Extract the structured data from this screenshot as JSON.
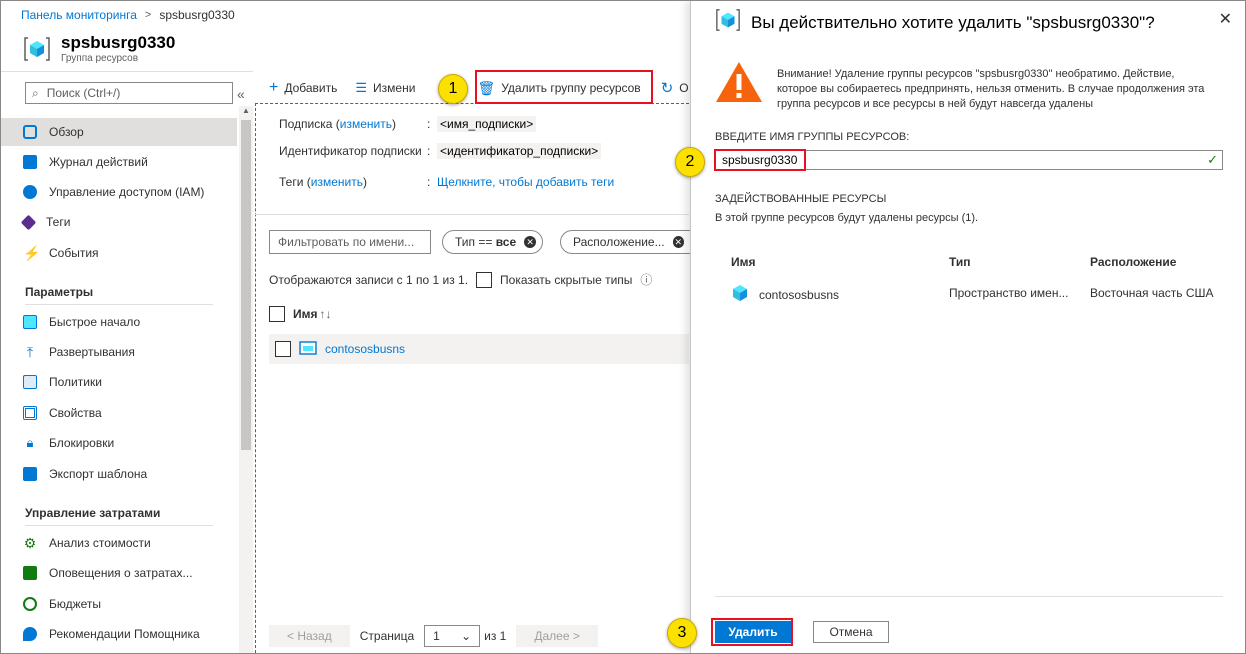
{
  "breadcrumb": {
    "home": "Панель мониторинга",
    "current": "spsbusrg0330"
  },
  "resource": {
    "name": "spsbusrg0330",
    "type": "Группа ресурсов"
  },
  "sidebar": {
    "search_placeholder": "Поиск (Ctrl+/)",
    "collapse": "«",
    "items": [
      {
        "label": "Обзор",
        "icon": "overview-icon",
        "color": "#0078d4"
      },
      {
        "label": "Журнал действий",
        "icon": "activity-log-icon",
        "color": "#0078d4"
      },
      {
        "label": "Управление доступом (IAM)",
        "icon": "iam-icon",
        "color": "#0078d4"
      },
      {
        "label": "Теги",
        "icon": "tag-icon",
        "color": "#5c2d91"
      },
      {
        "label": "События",
        "icon": "lightning-icon",
        "color": "#ffb900"
      }
    ],
    "section_params": "Параметры",
    "params": [
      {
        "label": "Быстрое начало",
        "icon": "quickstart-icon",
        "color": "#0078d4"
      },
      {
        "label": "Развертывания",
        "icon": "deployments-icon",
        "color": "#0078d4"
      },
      {
        "label": "Политики",
        "icon": "policies-icon",
        "color": "#0078d4"
      },
      {
        "label": "Свойства",
        "icon": "properties-icon",
        "color": "#0078d4"
      },
      {
        "label": "Блокировки",
        "icon": "lock-icon",
        "color": "#0078d4"
      },
      {
        "label": "Экспорт шаблона",
        "icon": "export-template-icon",
        "color": "#0078d4"
      }
    ],
    "section_costs": "Управление затратами",
    "costs": [
      {
        "label": "Анализ стоимости",
        "icon": "cost-analysis-icon",
        "color": "#107c10"
      },
      {
        "label": "Оповещения о затратах...",
        "icon": "cost-alerts-icon",
        "color": "#107c10"
      },
      {
        "label": "Бюджеты",
        "icon": "budgets-icon",
        "color": "#107c10"
      },
      {
        "label": "Рекомендации Помощника",
        "icon": "advisor-icon",
        "color": "#0078d4"
      }
    ]
  },
  "toolbar": {
    "add": "Добавить",
    "edit": "Измени",
    "delete_rg": "Удалить группу ресурсов",
    "refresh": "О"
  },
  "essentials": {
    "subscription_label": "Подписка (",
    "change": "изменить",
    "close_paren": ")",
    "subscription_value": "<имя_подписки>",
    "sub_id_label": "Идентификатор подписки",
    "sub_id_value": "<идентификатор_подписки>",
    "tags_label": "Теги (",
    "tags_link": "Щелкните, чтобы добавить теги",
    "colon": ":"
  },
  "filters": {
    "name_placeholder": "Фильтровать по имени...",
    "type_pill": "Тип == ",
    "type_value": "все",
    "location_pill": "Расположение..."
  },
  "records": {
    "text": "Отображаются записи с 1 по 1 из 1.",
    "show_hidden": "Показать скрытые типы",
    "info": "ⓘ"
  },
  "table": {
    "header_name": "Имя",
    "sort": "↑↓",
    "rows": [
      {
        "name": "contososbusns"
      }
    ]
  },
  "pager": {
    "prev": "< Назад",
    "page_label": "Страница",
    "page_value": "1",
    "of": "из 1",
    "next": "Далее >"
  },
  "blade": {
    "title": "Вы действительно хотите удалить \"spsbusrg0330\"?",
    "close": "✕",
    "warning": "Внимание! Удаление группы ресурсов \"spsbusrg0330\" необратимо. Действие, которое вы собираетесь предпринять, нельзя отменить. В случае продолжения эта группа ресурсов и все ресурсы в ней будут навсегда удалены",
    "input_label": "ВВЕДИТЕ ИМЯ ГРУППЫ РЕСУРСОВ:",
    "input_value": "spsbusrg0330",
    "affected_label": "ЗАДЕЙСТВОВАННЫЕ РЕСУРСЫ",
    "affected_desc": "В этой группе ресурсов будут удалены ресурсы (1).",
    "columns": {
      "name": "Имя",
      "type": "Тип",
      "location": "Расположение"
    },
    "resources": [
      {
        "name": "contososbusns",
        "type": "Пространство имен...",
        "location": "Восточная часть США"
      }
    ],
    "delete": "Удалить",
    "cancel": "Отмена"
  },
  "callouts": [
    "1",
    "2",
    "3"
  ],
  "colors": {
    "accent": "#0078d4",
    "warning": "#f7630c",
    "highlight": "#e81123",
    "callout": "#fce100"
  }
}
